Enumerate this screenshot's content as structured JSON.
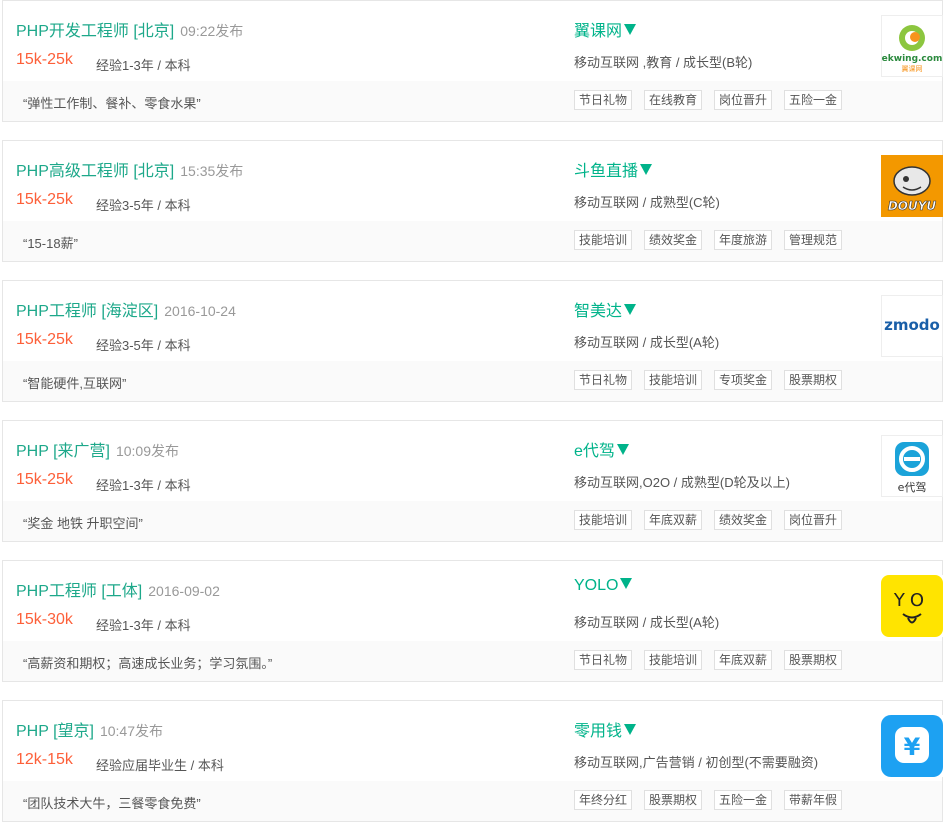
{
  "jobs": [
    {
      "position": "PHP开发工程师",
      "district": "[北京]",
      "time": "09:22发布",
      "salary": "15k-25k",
      "requirement": "经验1-3年 / 本科",
      "quote": "“弹性工作制、餐补、零食水果”",
      "company": "翼课网",
      "industry": "移动互联网 ,教育 / 成长型(B轮)",
      "tags": [
        "节日礼物",
        "在线教育",
        "岗位晋升",
        "五险一金"
      ],
      "logo": {
        "icon": "ekwing-logo",
        "text": "ekwing.com",
        "subtext": "翼课网"
      }
    },
    {
      "position": "PHP高级工程师",
      "district": "[北京]",
      "time": "15:35发布",
      "salary": "15k-25k",
      "requirement": "经验3-5年 / 本科",
      "quote": "“15-18薪”",
      "company": "斗鱼直播",
      "industry": "移动互联网 / 成熟型(C轮)",
      "tags": [
        "技能培训",
        "绩效奖金",
        "年度旅游",
        "管理规范"
      ],
      "logo": {
        "icon": "douyu-logo",
        "text": "DOUYU"
      }
    },
    {
      "position": "PHP工程师",
      "district": "[海淀区]",
      "time": "2016-10-24",
      "salary": "15k-25k",
      "requirement": "经验3-5年 / 本科",
      "quote": "“智能硬件,互联网”",
      "company": "智美达",
      "industry": "移动互联网 / 成长型(A轮)",
      "tags": [
        "节日礼物",
        "技能培训",
        "专项奖金",
        "股票期权"
      ],
      "logo": {
        "icon": "zmodo-logo",
        "text": "zmodo"
      }
    },
    {
      "position": "PHP",
      "district": "[来广营]",
      "time": "10:09发布",
      "salary": "15k-25k",
      "requirement": "经验1-3年 / 本科",
      "quote": "“奖金 地铁 升职空间”",
      "company": "e代驾",
      "industry": "移动互联网,O2O / 成熟型(D轮及以上)",
      "tags": [
        "技能培训",
        "年底双薪",
        "绩效奖金",
        "岗位晋升"
      ],
      "logo": {
        "icon": "edaijia-logo",
        "text": "e代驾"
      }
    },
    {
      "position": "PHP工程师",
      "district": "[工体]",
      "time": "2016-09-02",
      "salary": "15k-30k",
      "requirement": "经验1-3年 / 本科",
      "quote": "“高薪资和期权；高速成长业务；学习氛围。”",
      "company": "YOLO",
      "industry": "移动互联网 / 成长型(A轮)",
      "tags": [
        "节日礼物",
        "技能培训",
        "年底双薪",
        "股票期权"
      ],
      "logo": {
        "icon": "yolo-logo",
        "text": "YO"
      }
    },
    {
      "position": "PHP",
      "district": "[望京]",
      "time": "10:47发布",
      "salary": "12k-15k",
      "requirement": "经验应届毕业生 / 本科",
      "quote": "“团队技术大牛，三餐零食免费”",
      "company": "零用钱",
      "industry": "移动互联网,广告营销 / 初创型(不需要融资)",
      "tags": [
        "年终分红",
        "股票期权",
        "五险一金",
        "带薪年假"
      ],
      "logo": {
        "icon": "lingyongqian-logo",
        "text": "¥"
      }
    }
  ],
  "colors": {
    "accent": "#00b38a",
    "salary": "#fd5f39",
    "border": "#e6e6e6",
    "bottom_bg": "#fafafa",
    "douyu_bg": "#f39800",
    "yolo_bg": "#ffe400",
    "lingyongqian_bg": "#1da1f2"
  }
}
